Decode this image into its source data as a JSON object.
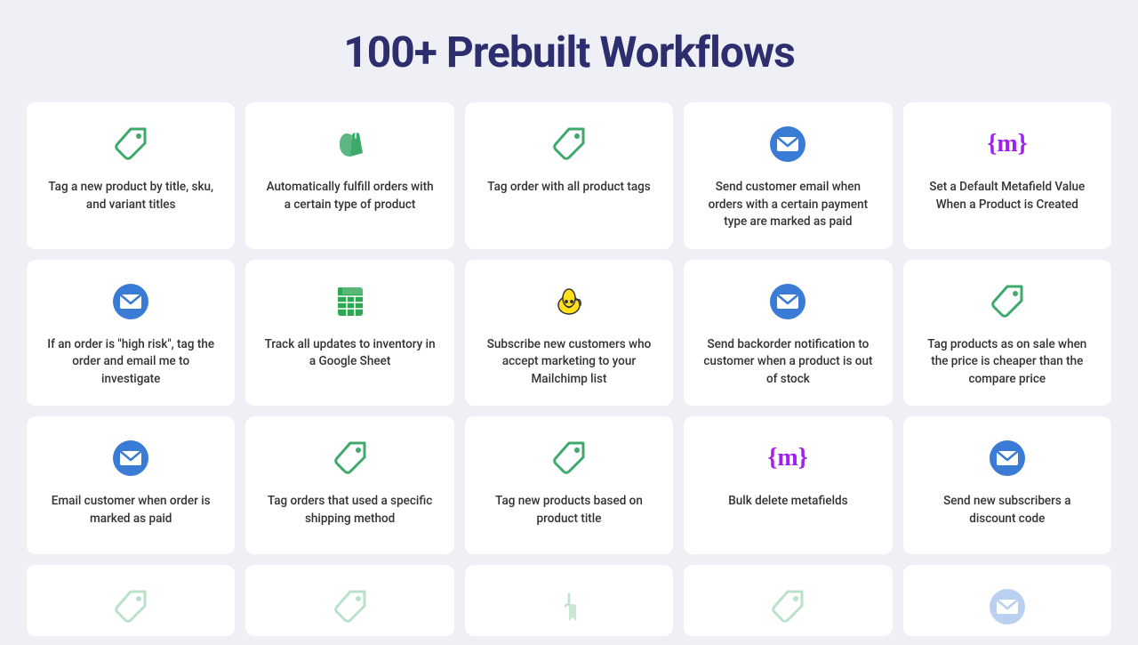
{
  "page": {
    "title": "100+ Prebuilt Workflows"
  },
  "cards": [
    {
      "id": "tag-new-product",
      "text": "Tag a new product by title, sku, and variant titles",
      "icon": "tag",
      "icon_color": "#3daa6b"
    },
    {
      "id": "auto-fulfill",
      "text": "Automatically fulfill orders with a certain type of product",
      "icon": "shopify",
      "icon_color": "#3daa6b"
    },
    {
      "id": "tag-order-product-tags",
      "text": "Tag order with all product tags",
      "icon": "tag",
      "icon_color": "#3daa6b"
    },
    {
      "id": "send-customer-email-payment",
      "text": "Send customer email when orders with a certain payment type are marked as paid",
      "icon": "email",
      "icon_color": "#3a7bd5"
    },
    {
      "id": "set-default-metafield",
      "text": "Set a Default Metafield Value When a Product is Created",
      "icon": "metafield",
      "icon_color": "#a020f0"
    },
    {
      "id": "high-risk-order",
      "text": "If an order is \"high risk\", tag the order and email me to investigate",
      "icon": "email",
      "icon_color": "#3a7bd5"
    },
    {
      "id": "track-inventory-google",
      "text": "Track all updates to inventory in a Google Sheet",
      "icon": "sheets",
      "icon_color": "#2da853"
    },
    {
      "id": "subscribe-mailchimp",
      "text": "Subscribe new customers who accept marketing to your Mailchimp list",
      "icon": "mailchimp",
      "icon_color": "#ffe01b"
    },
    {
      "id": "backorder-notification",
      "text": "Send backorder notification to customer when a product is out of stock",
      "icon": "email",
      "icon_color": "#3a7bd5"
    },
    {
      "id": "tag-on-sale",
      "text": "Tag products as on sale when the price is cheaper than the compare price",
      "icon": "tag",
      "icon_color": "#3daa6b"
    },
    {
      "id": "email-order-paid",
      "text": "Email customer when order is marked as paid",
      "icon": "email",
      "icon_color": "#3a7bd5"
    },
    {
      "id": "tag-shipping-method",
      "text": "Tag orders that used a specific shipping method",
      "icon": "tag",
      "icon_color": "#3daa6b"
    },
    {
      "id": "tag-new-products-title",
      "text": "Tag new products based on product title",
      "icon": "tag",
      "icon_color": "#3daa6b"
    },
    {
      "id": "bulk-delete-metafields",
      "text": "Bulk delete metafields",
      "icon": "metafield",
      "icon_color": "#a020f0"
    },
    {
      "id": "send-subscribers-discount",
      "text": "Send new subscribers a discount code",
      "icon": "email",
      "icon_color": "#3a7bd5"
    },
    {
      "id": "partial-1",
      "text": "",
      "icon": "tag",
      "icon_color": "#3daa6b",
      "partial": true
    },
    {
      "id": "partial-2",
      "text": "",
      "icon": "tag",
      "icon_color": "#3daa6b",
      "partial": true
    },
    {
      "id": "partial-3",
      "text": "",
      "icon": "touch",
      "icon_color": "#3daa6b",
      "partial": true
    },
    {
      "id": "partial-4",
      "text": "",
      "icon": "tag",
      "icon_color": "#3daa6b",
      "partial": true
    },
    {
      "id": "partial-5",
      "text": "",
      "icon": "email",
      "icon_color": "#3a7bd5",
      "partial": true
    }
  ]
}
